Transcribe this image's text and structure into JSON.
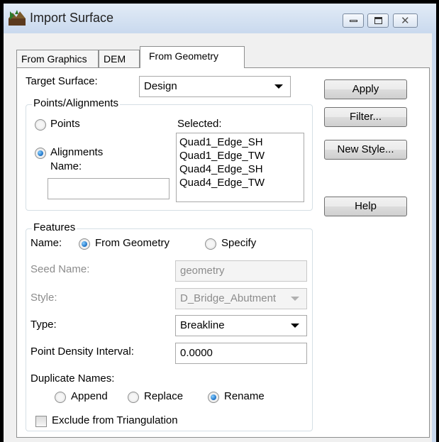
{
  "window": {
    "title": "Import Surface",
    "icon": "app-icon",
    "controls": [
      "minimize",
      "maximize",
      "close"
    ]
  },
  "tabs": [
    {
      "label": "From Graphics",
      "active": false
    },
    {
      "label": "DEM",
      "active": false
    },
    {
      "label": "From Geometry",
      "active": true
    }
  ],
  "target_surface": {
    "label": "Target Surface:",
    "value": "Design"
  },
  "points_alignments": {
    "title": "Points/Alignments",
    "points_label": "Points",
    "alignments_label": "Alignments",
    "selected_option": "Alignments",
    "name_label": "Name:",
    "name_value": "",
    "selected_label": "Selected:",
    "selected_items": [
      "Quad1_Edge_SH",
      "Quad1_Edge_TW",
      "Quad4_Edge_SH",
      "Quad4_Edge_TW"
    ]
  },
  "buttons": {
    "apply": "Apply",
    "filter": "Filter...",
    "new_style": "New Style...",
    "help": "Help"
  },
  "features": {
    "title": "Features",
    "name_label": "Name:",
    "from_geometry_label": "From Geometry",
    "specify_label": "Specify",
    "name_option": "From Geometry",
    "seed_name_label": "Seed Name:",
    "seed_name_value": "geometry",
    "style_label": "Style:",
    "style_value": "D_Bridge_Abutment",
    "type_label": "Type:",
    "type_value": "Breakline",
    "density_label": "Point Density Interval:",
    "density_value": "0.0000",
    "duplicate_label": "Duplicate Names:",
    "append_label": "Append",
    "replace_label": "Replace",
    "rename_label": "Rename",
    "duplicate_option": "Rename",
    "exclude_label": "Exclude from Triangulation",
    "exclude_checked": false
  }
}
